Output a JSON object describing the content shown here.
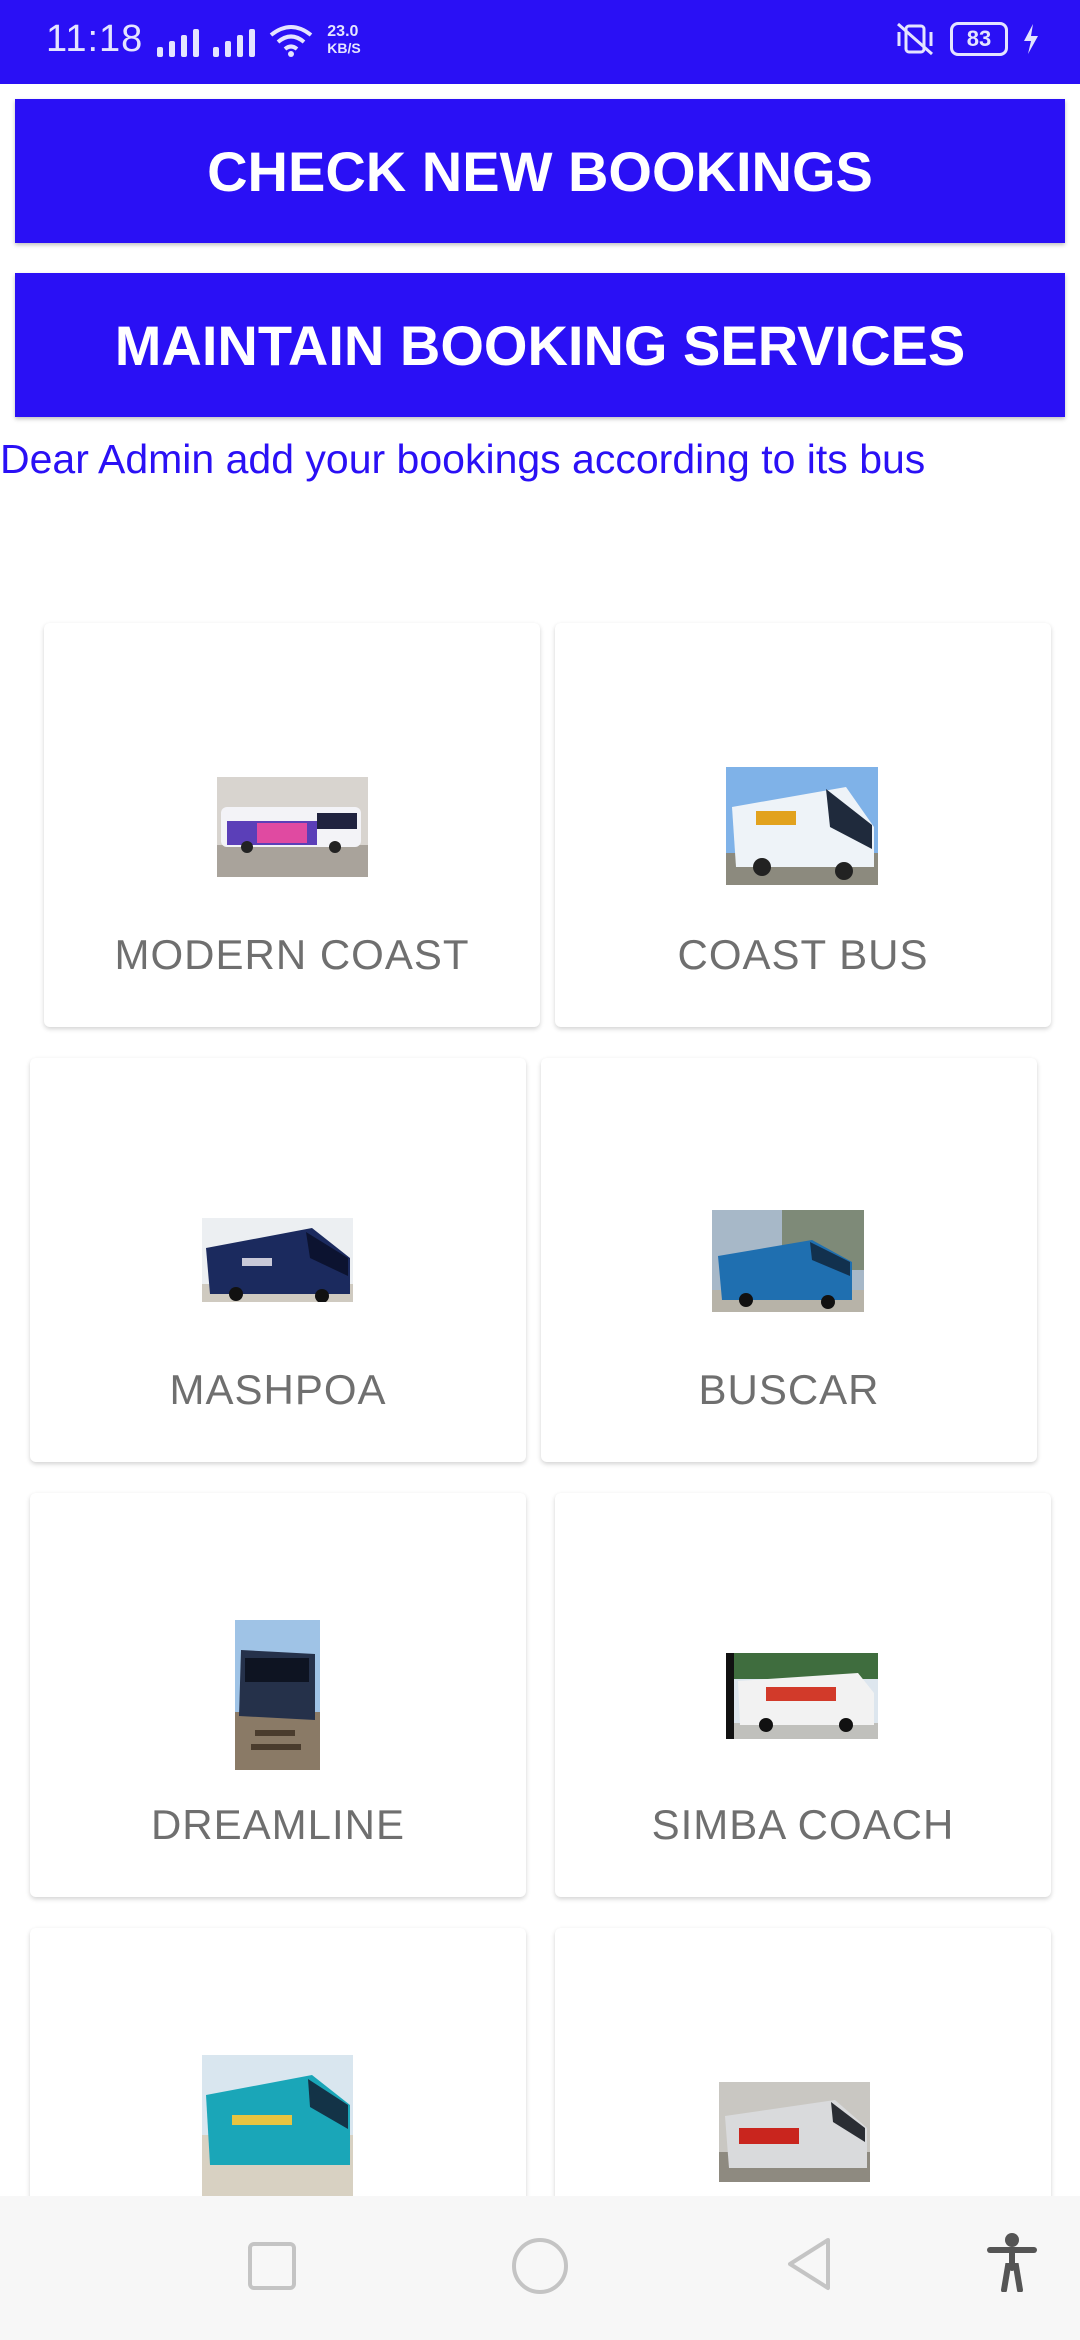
{
  "status_bar": {
    "time": "11:18",
    "network_speed": "23.0",
    "network_unit": "KB/S",
    "battery": "83"
  },
  "buttons": {
    "check_new_bookings": "CHECK NEW BOOKINGS",
    "maintain_booking_services": "MAINTAIN BOOKING SERVICES"
  },
  "hint_text": "Dear Admin add your bookings according to its bus",
  "buses": [
    {
      "name": "MODERN COAST",
      "icon": "bus-photo"
    },
    {
      "name": "COAST BUS",
      "icon": "bus-photo"
    },
    {
      "name": "MASHPOA",
      "icon": "bus-photo"
    },
    {
      "name": "BUSCAR",
      "icon": "bus-photo"
    },
    {
      "name": "DREAMLINE",
      "icon": "bus-photo"
    },
    {
      "name": "SIMBA COACH",
      "icon": "bus-photo"
    },
    {
      "name": "",
      "icon": "bus-photo"
    },
    {
      "name": "",
      "icon": "bus-photo"
    }
  ],
  "colors": {
    "accent": "#2a10f5",
    "card_label": "#6f6f6f",
    "nav_bar": "#f7f7f7"
  }
}
